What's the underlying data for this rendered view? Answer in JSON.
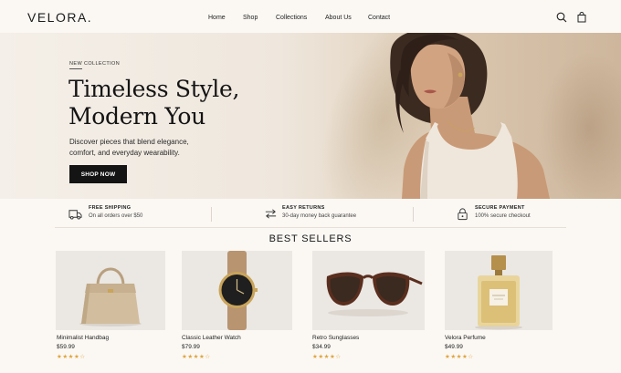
{
  "header": {
    "logo": "VELORA.",
    "nav": [
      "Home",
      "Shop",
      "Collections",
      "About Us",
      "Contact"
    ],
    "icons": [
      "search-icon",
      "bag-icon"
    ]
  },
  "hero": {
    "eyebrow": "NEW COLLECTION",
    "title_line1": "Timeless Style,",
    "title_line2": "Modern You",
    "description": "Discover pieces that blend elegance, comfort, and everyday wearability.",
    "cta_label": "SHOP NOW"
  },
  "features": [
    {
      "icon": "truck-icon",
      "title": "FREE SHIPPING",
      "subtitle": "On all orders over $50"
    },
    {
      "icon": "returns-icon",
      "title": "EASY RETURNS",
      "subtitle": "30-day money back guarantee"
    },
    {
      "icon": "lock-icon",
      "title": "SECURE PAYMENT",
      "subtitle": "100% secure checkout"
    }
  ],
  "best_sellers": {
    "title": "BEST SELLERS",
    "products": [
      {
        "name": "Minimalist Handbag",
        "price": "$59.99",
        "rating": 4,
        "stars": "★★★★☆",
        "image": "handbag-image"
      },
      {
        "name": "Classic Leather Watch",
        "price": "$79.99",
        "rating": 4,
        "stars": "★★★★☆",
        "image": "watch-image"
      },
      {
        "name": "Retro Sunglasses",
        "price": "$34.99",
        "rating": 4,
        "stars": "★★★★☆",
        "image": "sunglasses-image"
      },
      {
        "name": "Velora Perfume",
        "price": "$49.99",
        "rating": 4,
        "stars": "★★★★☆",
        "image": "perfume-image"
      }
    ]
  },
  "colors": {
    "accent": "#141414",
    "star": "#e0a43a",
    "background": "#fbf8f4"
  }
}
